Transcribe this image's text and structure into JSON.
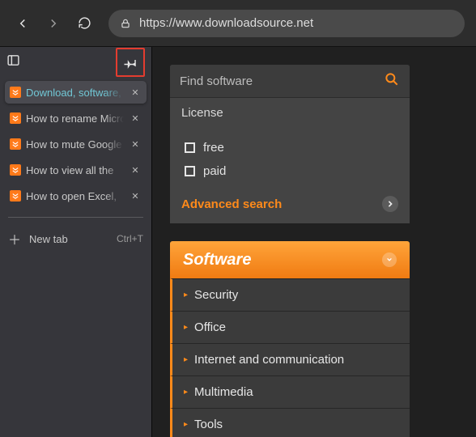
{
  "browser": {
    "url": "https://www.downloadsource.net",
    "tabs": [
      {
        "label": "Download, software, drivers"
      },
      {
        "label": "How to rename Microsoft"
      },
      {
        "label": "How to mute Google"
      },
      {
        "label": "How to view all the"
      },
      {
        "label": "How to open Excel,"
      }
    ],
    "newtab_label": "New tab",
    "newtab_shortcut": "Ctrl+T"
  },
  "search": {
    "placeholder": "Find software",
    "license_heading": "License",
    "option_free": "free",
    "option_paid": "paid",
    "advanced_label": "Advanced search"
  },
  "software": {
    "heading": "Software",
    "categories": [
      "Security",
      "Office",
      "Internet and communication",
      "Multimedia",
      "Tools"
    ]
  }
}
